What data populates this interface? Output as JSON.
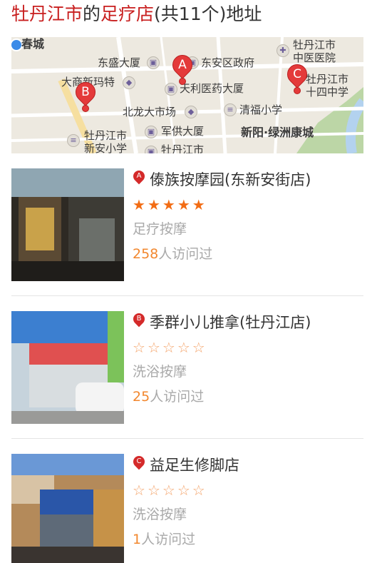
{
  "page": {
    "title_city": "牡丹江市",
    "title_connector": "的",
    "title_category": "足疗店",
    "title_suffix": "(共11个)地址"
  },
  "map": {
    "labels": [
      "春城",
      "东盛大厦",
      "东安区政府",
      "牡丹江市",
      "中医医院",
      "大商新玛特",
      "天利医药大厦",
      "牡丹江市",
      "十四中学",
      "北龙大市场",
      "清福小学",
      "牡丹江市",
      "新安小学",
      "军供大厦",
      "牡丹江市",
      "新阳·绿洲康城"
    ],
    "markers": [
      "A",
      "B",
      "C"
    ]
  },
  "listings": [
    {
      "marker": "A",
      "name": "傣族按摩园(东新安街店)",
      "rating": 5,
      "category": "足疗按摩",
      "visits_count": "258",
      "visits_suffix": "人访问过"
    },
    {
      "marker": "B",
      "name": "季群小儿推拿(牡丹江店)",
      "rating": 0,
      "category": "洗浴按摩",
      "visits_count": "25",
      "visits_suffix": "人访问过"
    },
    {
      "marker": "C",
      "name": "益足生修脚店",
      "rating": 0,
      "category": "洗浴按摩",
      "visits_count": "1",
      "visits_suffix": "人访问过"
    }
  ],
  "colors": {
    "accent_red": "#c81e1e",
    "star_orange": "#f26c14",
    "visits_orange": "#f2872e",
    "muted_text": "#a9a9a9"
  }
}
